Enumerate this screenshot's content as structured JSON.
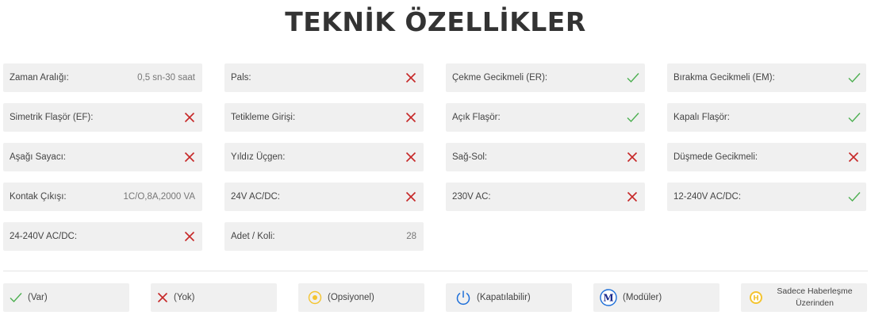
{
  "title": "TEKNİK ÖZELLİKLER",
  "colors": {
    "yes": "#4caf50",
    "no": "#c62828",
    "optional": "#f4c430",
    "power": "#1e6fd9",
    "modular": "#1a2a8c"
  },
  "specs": [
    [
      {
        "label": "Zaman Aralığı:",
        "value": "0,5 sn-30 saat"
      },
      {
        "label": "Pals:",
        "icon": "cross-icon"
      },
      {
        "label": "Çekme Gecikmeli (ER):",
        "icon": "check-icon"
      },
      {
        "label": "Bırakma Gecikmeli (EM):",
        "icon": "check-icon"
      }
    ],
    [
      {
        "label": "Simetrik Flaşör (EF):",
        "icon": "cross-icon"
      },
      {
        "label": "Tetikleme Girişi:",
        "icon": "cross-icon"
      },
      {
        "label": "Açık Flaşör:",
        "icon": "check-icon"
      },
      {
        "label": "Kapalı Flaşör:",
        "icon": "check-icon"
      }
    ],
    [
      {
        "label": "Aşağı Sayacı:",
        "icon": "cross-icon"
      },
      {
        "label": "Yıldız Üçgen:",
        "icon": "cross-icon"
      },
      {
        "label": "Sağ-Sol:",
        "icon": "cross-icon"
      },
      {
        "label": "Düşmede Gecikmeli:",
        "icon": "cross-icon"
      }
    ],
    [
      {
        "label": "Kontak Çıkışı:",
        "value": "1C/O,8A,2000 VA"
      },
      {
        "label": "24V AC/DC:",
        "icon": "cross-icon"
      },
      {
        "label": "230V AC:",
        "icon": "cross-icon"
      },
      {
        "label": "12-240V AC/DC:",
        "icon": "check-icon"
      }
    ],
    [
      {
        "label": "24-240V AC/DC:",
        "icon": "cross-icon"
      },
      {
        "label": "Adet / Koli:",
        "value": "28"
      }
    ]
  ],
  "legend": {
    "var": "(Var)",
    "yok": "(Yok)",
    "opsiyonel": "(Opsiyonel)",
    "kapatilabilir": "(Kapatılabilir)",
    "moduler": "(Modüler)",
    "moduler_letter": "M",
    "haberlesme_letter": "H",
    "haberlesme_line1": "Sadece Haberleşme",
    "haberlesme_line2": "Üzerinden"
  }
}
